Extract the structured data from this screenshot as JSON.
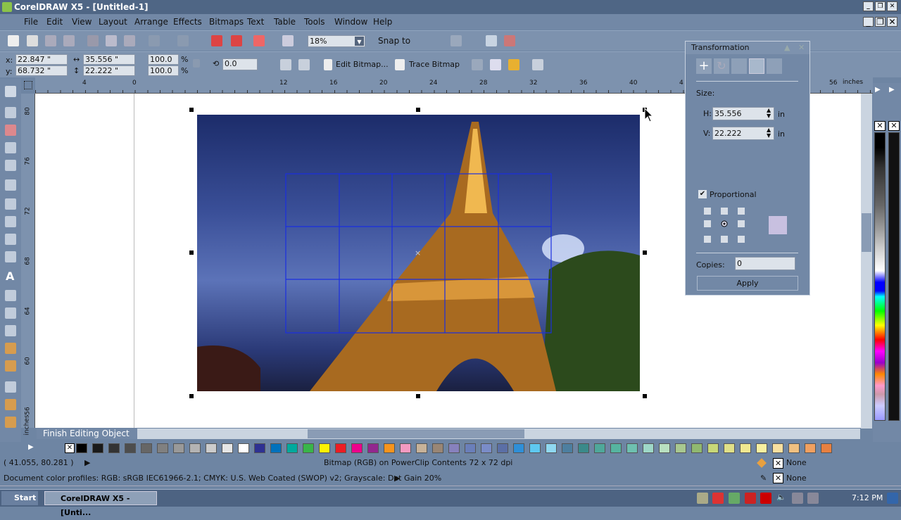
{
  "window": {
    "title": "CorelDRAW X5 - [Untitled-1]"
  },
  "menu": [
    "File",
    "Edit",
    "View",
    "Layout",
    "Arrange",
    "Effects",
    "Bitmaps",
    "Text",
    "Table",
    "Tools",
    "Window",
    "Help"
  ],
  "toolbar": {
    "zoom": "18%",
    "snap_to": "Snap to"
  },
  "propbar": {
    "x": "22.847 \"",
    "y": "68.732 \"",
    "w": "35.556 \"",
    "h": "22.222 \"",
    "scale_x": "100.0",
    "scale_y": "100.0",
    "pct": "%",
    "angle": "0.0",
    "edit_bitmap": "Edit Bitmap...",
    "trace_bitmap": "Trace Bitmap"
  },
  "ruler": {
    "unit": "inches",
    "top": [
      "4",
      "0",
      "12",
      "16",
      "20",
      "24",
      "28",
      "32",
      "36",
      "40",
      "4",
      "56"
    ],
    "left": [
      "80",
      "76",
      "72",
      "68",
      "64",
      "60",
      "56"
    ],
    "left_unit": "inches"
  },
  "canvas": {
    "finish_editing": "Finish Editing Object"
  },
  "transformation": {
    "title": "Transformation",
    "size_label": "Size:",
    "h_label": "H:",
    "h_value": "35.556",
    "v_label": "V:",
    "v_value": "22.222",
    "unit": "in",
    "proportional": "Proportional",
    "proportional_checked": true,
    "copies_label": "Copies:",
    "copies_value": "0",
    "apply": "Apply"
  },
  "palette_colors": [
    "#000000",
    "#1a1a1a",
    "#333333",
    "#4d4d4d",
    "#666666",
    "#808080",
    "#999999",
    "#b3b3b3",
    "#cccccc",
    "#e6e6e6",
    "#ffffff",
    "#2e3192",
    "#0071bc",
    "#00a99d",
    "#39b54a",
    "#fff200",
    "#ed1c24",
    "#ec008c",
    "#92278f",
    "#f7941d",
    "#f49ac1",
    "#c7b299",
    "#998675",
    "#8781bd",
    "#6a7fba",
    "#7a8cc8",
    "#5b6fa6",
    "#2f8fd8",
    "#5ec8f0",
    "#8fd8f0",
    "#4d7fa0",
    "#3a8a8a",
    "#4fa89a",
    "#56b4a0",
    "#6ec0b0",
    "#9ed8c8",
    "#b8e0c0",
    "#a8c890",
    "#90b870",
    "#c8d878",
    "#e0e088",
    "#f0e890",
    "#f8f0a0",
    "#f8e0a0",
    "#f0c080",
    "#f0a060",
    "#e88040"
  ],
  "status": {
    "coords": "( 41.055, 80.281 )",
    "object_info": "Bitmap (RGB) on PowerClip Contents 72 x 72 dpi",
    "profiles": "Document color profiles: RGB: sRGB IEC61966-2.1; CMYK: U.S. Web Coated (SWOP) v2; Grayscale: Dot Gain 20%",
    "fill": "None",
    "outline": "None"
  },
  "taskbar": {
    "start": "Start",
    "task": "CorelDRAW X5 - [Unti...",
    "clock": "7:12 PM"
  }
}
